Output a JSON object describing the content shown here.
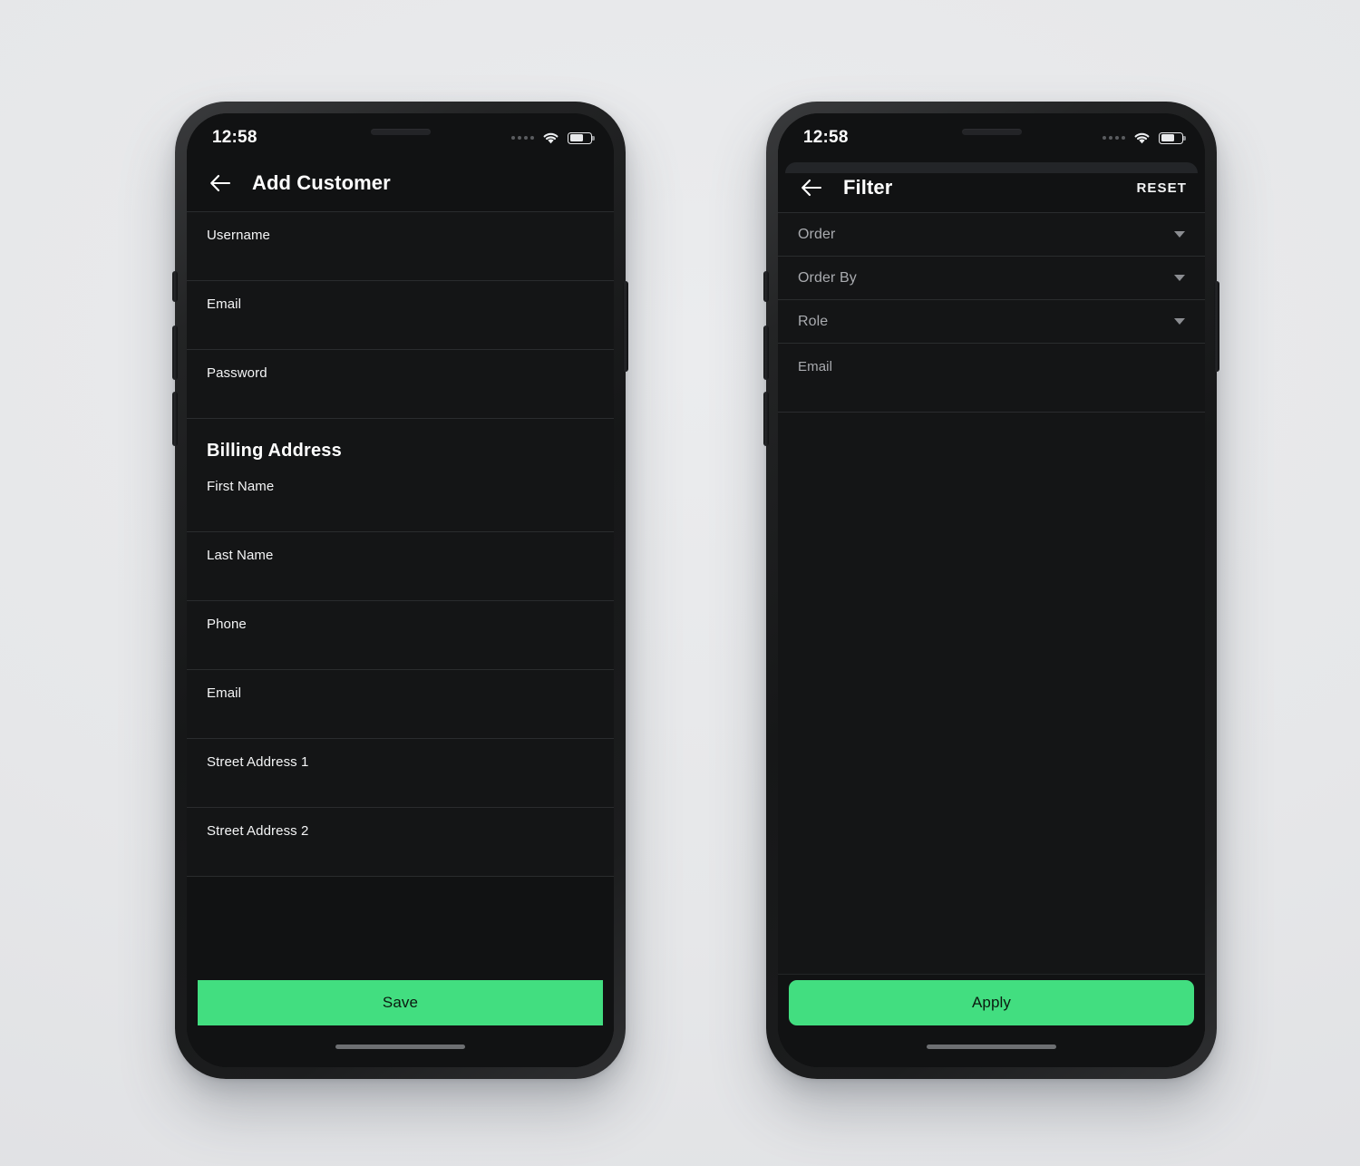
{
  "meta": {
    "background_color": "#e7e8ea",
    "accent_color": "#42de80",
    "screen_background": "#141516"
  },
  "phones": [
    {
      "id": "add-customer",
      "status_bar": {
        "time": "12:58",
        "signal_icon": "signal-dots-icon",
        "wifi_icon": "wifi-icon",
        "battery_icon": "battery-icon",
        "battery_level": "65"
      },
      "app_bar": {
        "back_icon": "back-arrow-icon",
        "title": "Add Customer",
        "action_label": ""
      },
      "fields": [
        {
          "label": "Username",
          "type": "text",
          "muted": false
        },
        {
          "label": "Email",
          "type": "text",
          "muted": false
        },
        {
          "label": "Password",
          "type": "text",
          "muted": false
        }
      ],
      "section": {
        "title": "Billing Address"
      },
      "billing_fields": [
        {
          "label": "First Name",
          "type": "text",
          "muted": false
        },
        {
          "label": "Last Name",
          "type": "text",
          "muted": false
        },
        {
          "label": "Phone",
          "type": "text",
          "muted": false
        },
        {
          "label": "Email",
          "type": "text",
          "muted": false
        },
        {
          "label": "Street Address 1",
          "type": "text",
          "muted": false
        },
        {
          "label": "Street Address 2",
          "type": "text",
          "muted": false
        }
      ],
      "cta": {
        "label": "Save",
        "shape": "square",
        "color": "#42de80"
      }
    },
    {
      "id": "filter",
      "status_bar": {
        "time": "12:58",
        "signal_icon": "signal-dots-icon",
        "wifi_icon": "wifi-icon",
        "battery_icon": "battery-icon",
        "battery_level": "65"
      },
      "app_bar": {
        "back_icon": "back-arrow-icon",
        "title": "Filter",
        "action_label": "RESET"
      },
      "fields": [
        {
          "label": "Order",
          "type": "dropdown",
          "muted": true,
          "caret_icon": "chevron-down-icon"
        },
        {
          "label": "Order By",
          "type": "dropdown",
          "muted": true,
          "caret_icon": "chevron-down-icon"
        },
        {
          "label": "Role",
          "type": "dropdown",
          "muted": true,
          "caret_icon": "chevron-down-icon"
        },
        {
          "label": "Email",
          "type": "text",
          "muted": true
        }
      ],
      "cta": {
        "label": "Apply",
        "shape": "round",
        "color": "#42de80"
      }
    }
  ]
}
